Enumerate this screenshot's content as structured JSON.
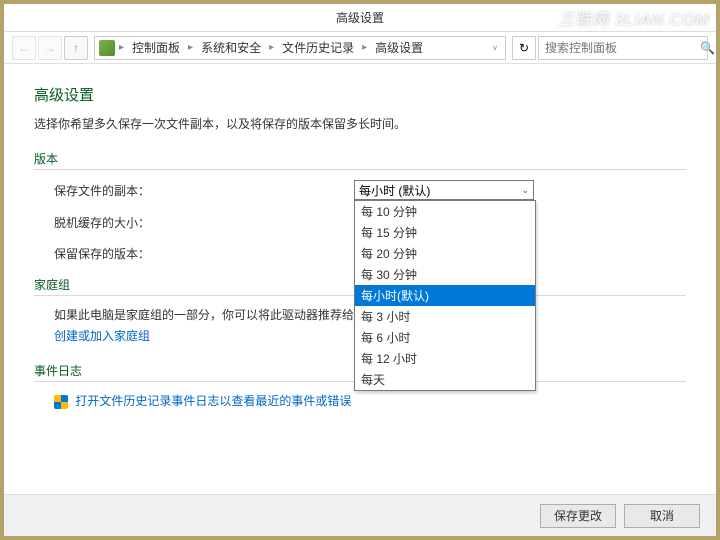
{
  "watermark": "三联网 3LIAN.COM",
  "titlebar": {
    "title": "高级设置"
  },
  "nav": {
    "breadcrumb": [
      "控制面板",
      "系统和安全",
      "文件历史记录",
      "高级设置"
    ],
    "search_placeholder": "搜索控制面板"
  },
  "page": {
    "title": "高级设置",
    "description": "选择你希望多久保存一次文件副本，以及将保存的版本保留多长时间。"
  },
  "sections": {
    "versions": {
      "header": "版本",
      "fields": {
        "save_copies": {
          "label": "保存文件的副本：",
          "value": "每小时 (默认)"
        },
        "cache_size": {
          "label": "脱机缓存的大小："
        },
        "keep_versions": {
          "label": "保留保存的版本："
        }
      },
      "dropdown_options": [
        "每 10 分钟",
        "每 15 分钟",
        "每 20 分钟",
        "每 30 分钟",
        "每小时(默认)",
        "每 3 小时",
        "每 6 小时",
        "每 12 小时",
        "每天"
      ],
      "dropdown_selected_index": 4
    },
    "homegroup": {
      "header": "家庭组",
      "text": "如果此电脑是家庭组的一部分，你可以将此驱动器推荐给其他家庭组",
      "link": "创建或加入家庭组"
    },
    "eventlog": {
      "header": "事件日志",
      "link": "打开文件历史记录事件日志以查看最近的事件或错误"
    }
  },
  "footer": {
    "save": "保存更改",
    "cancel": "取消"
  }
}
